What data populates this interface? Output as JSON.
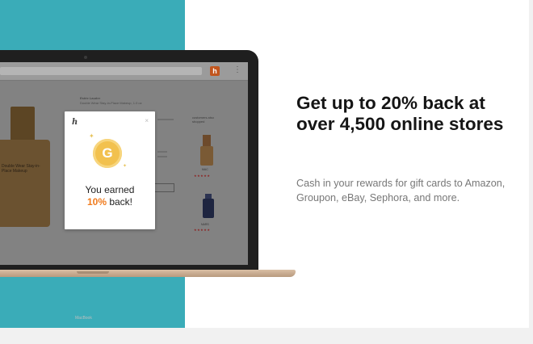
{
  "browser": {
    "extension_icon": "honey-h-icon",
    "menu_icon": "⋮"
  },
  "product": {
    "brand": "Estée Lauder",
    "name": "Double Wear Stay-in-Place Makeup, 1.0 oz",
    "bottle_label": "Double Wear Stay-in-Place Makeup"
  },
  "sidebar": {
    "heading": "customers also shopped",
    "items": [
      {
        "name": "MAC",
        "rating": "★★★★★"
      },
      {
        "name": "NARS",
        "rating": "★★★★★"
      }
    ]
  },
  "popup": {
    "logo": "h",
    "close": "×",
    "coin_symbol": "G",
    "line1": "You earned",
    "percent": "10%",
    "line2_rest": " back!"
  },
  "laptop": {
    "brand": "MacBook"
  },
  "promo": {
    "headline": "Get up to 20% back at over 4,500 online stores",
    "subtext": "Cash in your rewards for gift cards to Amazon, Groupon, eBay, Sephora, and more."
  },
  "colors": {
    "teal": "#3aacb8",
    "accent_orange": "#f07b1d",
    "coin_gold": "#f2c14e"
  }
}
